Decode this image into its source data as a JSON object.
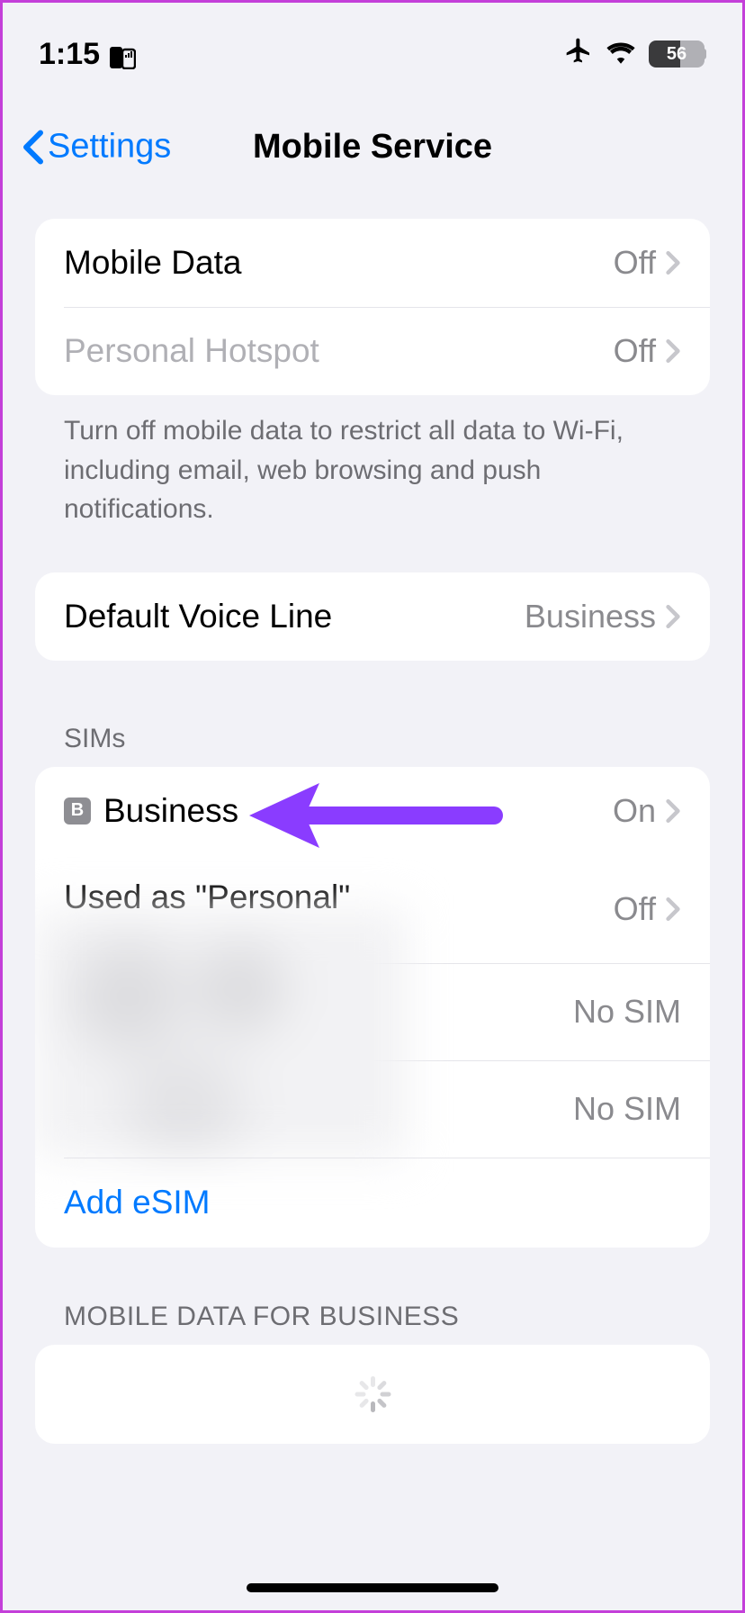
{
  "status": {
    "time": "1:15",
    "battery": "56"
  },
  "nav": {
    "back_label": "Settings",
    "title": "Mobile Service"
  },
  "group1": {
    "mobile_data": {
      "label": "Mobile Data",
      "value": "Off"
    },
    "hotspot": {
      "label": "Personal Hotspot",
      "value": "Off"
    },
    "footer": "Turn off mobile data to restrict all data to Wi-Fi, including email, web browsing and push notifications."
  },
  "group2": {
    "default_voice": {
      "label": "Default Voice Line",
      "value": "Business"
    }
  },
  "sims": {
    "header": "SIMs",
    "items": [
      {
        "badge": "B",
        "label": "Business",
        "value": "On"
      },
      {
        "label": "Used as \"Personal\"",
        "value": "Off"
      },
      {
        "value": "No SIM"
      },
      {
        "value": "No SIM"
      }
    ],
    "add_label": "Add eSIM"
  },
  "group4": {
    "header": "MOBILE DATA FOR BUSINESS"
  }
}
